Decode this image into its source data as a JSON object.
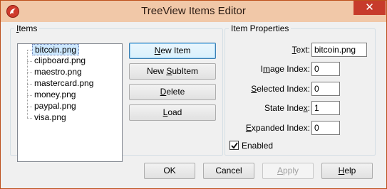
{
  "window": {
    "title": "TreeView Items Editor",
    "close_glyph": "✕",
    "app_icon": "app-logo-icon"
  },
  "items_group": {
    "legend": "Items",
    "legend_accel": "I",
    "legend_rest": "tems",
    "tree": [
      "bitcoin.png",
      "clipboard.png",
      "maestro.png",
      "mastercard.png",
      "money.png",
      "paypal.png",
      "visa.png"
    ],
    "selected_index": 0
  },
  "buttons": {
    "new_item": {
      "accel": "N",
      "rest": "ew Item"
    },
    "new_subitem": {
      "pre": "New ",
      "accel": "S",
      "rest": "ubItem"
    },
    "delete": {
      "accel": "D",
      "rest": "elete"
    },
    "load": {
      "accel": "L",
      "rest": "oad"
    },
    "ok": "OK",
    "cancel": "Cancel",
    "apply": {
      "accel": "A",
      "rest": "pply"
    },
    "help": {
      "accel": "H",
      "rest": "elp"
    }
  },
  "props_group": {
    "legend": "Item Properties",
    "text_label": {
      "accel": "T",
      "rest": "ext:"
    },
    "text_value": "bitcoin.png",
    "image_index_label": {
      "pre": "I",
      "accel": "m",
      "rest": "age Index:"
    },
    "image_index_value": "0",
    "selected_index_label": {
      "accel": "S",
      "rest": "elected Index:"
    },
    "selected_index_value": "0",
    "state_index_label": {
      "pre": "State Inde",
      "accel": "x",
      "rest": ":"
    },
    "state_index_value": "1",
    "expanded_index_label": {
      "accel": "E",
      "rest": "xpanded Index:"
    },
    "expanded_index_value": "0",
    "enabled_label": "Enabled",
    "enabled_checked": true
  }
}
